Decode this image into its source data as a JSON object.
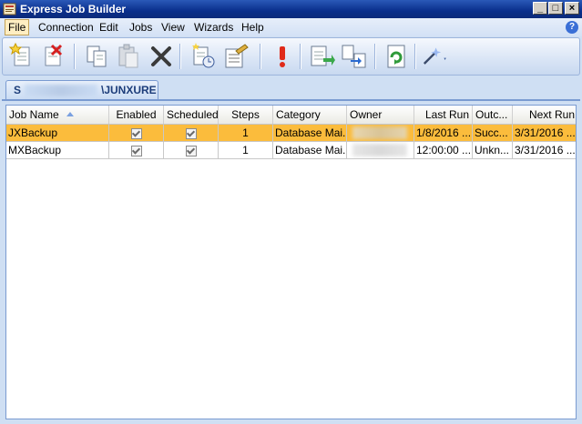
{
  "window": {
    "title": "Express Job Builder"
  },
  "menu": [
    "File",
    "Connection",
    "Edit",
    "Jobs",
    "View",
    "Wizards",
    "Help"
  ],
  "toolbar": {
    "icons": [
      "new-job-icon",
      "delete-job-icon",
      "copy-icon",
      "paste-icon",
      "cancel-x-icon",
      "new-schedule-icon",
      "properties-icon",
      "alert-icon",
      "script-icon",
      "transfer-icon",
      "document-icon",
      "refresh-icon",
      "wand-icon"
    ]
  },
  "tab": {
    "server_prefix": "S",
    "server_suffix": "\\JUNXURE"
  },
  "grid": {
    "columns": [
      "Job Name",
      "Enabled",
      "Scheduled",
      "Steps",
      "Category",
      "Owner",
      "Last Run",
      "Outc...",
      "Next Run"
    ],
    "rows": [
      {
        "name": "JXBackup",
        "enabled": true,
        "scheduled": true,
        "steps": "1",
        "category": "Database Mai...",
        "owner": "",
        "last_run": "1/8/2016 ...",
        "outcome": "Succ...",
        "next_run": "3/31/2016 ..."
      },
      {
        "name": "MXBackup",
        "enabled": true,
        "scheduled": true,
        "steps": "1",
        "category": "Database Mai...",
        "owner": "",
        "last_run": "12:00:00 ...",
        "outcome": "Unkn...",
        "next_run": "3/31/2016 ..."
      }
    ]
  },
  "colors": {
    "selected_row": "#fbbc3c",
    "titlebar": "#0a2f8c",
    "workspace": "#cfdff3"
  }
}
